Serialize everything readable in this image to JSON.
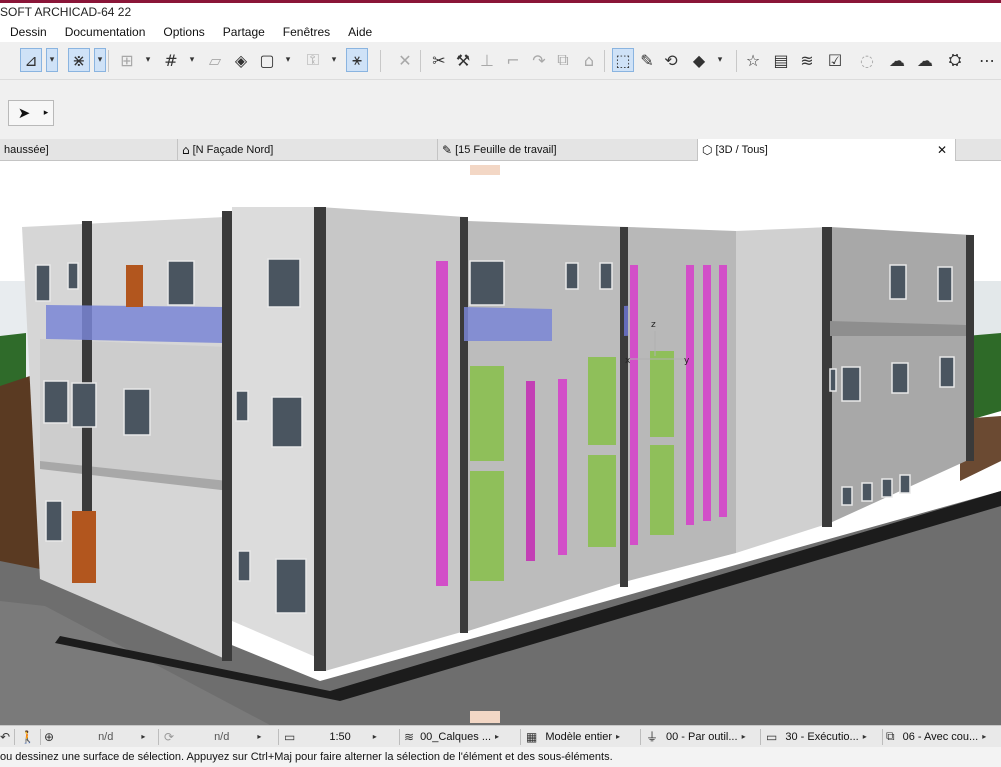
{
  "window": {
    "title": "SOFT ARCHICAD-64 22"
  },
  "menu": [
    "Dessin",
    "Documentation",
    "Options",
    "Partage",
    "Fenêtres",
    "Aide"
  ],
  "toolbar": {
    "icons": [
      {
        "name": "angle-snap-icon",
        "glyph": "⊿",
        "active": true
      },
      {
        "name": "dropdown-arrow-icon",
        "glyph": "▾",
        "small": true,
        "active": true
      },
      {
        "name": "guide-lines-icon",
        "glyph": "⋇",
        "active": true
      },
      {
        "name": "dropdown-arrow-icon",
        "glyph": "▾",
        "small": true,
        "active": true
      },
      {
        "name": "snap-points-icon",
        "glyph": "⊞",
        "dim": true
      },
      {
        "name": "dropdown-arrow-icon",
        "glyph": "▾",
        "small": true
      },
      {
        "name": "grid-icon",
        "glyph": "#"
      },
      {
        "name": "dropdown-arrow-icon",
        "glyph": "▾",
        "small": true
      },
      {
        "name": "slab-icon",
        "glyph": "▱",
        "dim": true
      },
      {
        "name": "plane-icon",
        "glyph": "◈"
      },
      {
        "name": "rectangle-icon",
        "glyph": "▢"
      },
      {
        "name": "dropdown-arrow-icon",
        "glyph": "▾",
        "small": true
      },
      {
        "name": "lock-icon",
        "glyph": "⚿",
        "dim": true
      },
      {
        "name": "dropdown-arrow-icon",
        "glyph": "▾",
        "small": true
      },
      {
        "name": "magic-wand-icon",
        "glyph": "⚹",
        "active": true
      },
      {
        "name": "cross-icon",
        "glyph": "✕",
        "dim": true
      },
      {
        "name": "scissors-icon",
        "glyph": "✂"
      },
      {
        "name": "hammer-icon",
        "glyph": "⚒"
      },
      {
        "name": "trim-icon",
        "glyph": "⊥",
        "dim": true
      },
      {
        "name": "corner-icon",
        "glyph": "⌐",
        "dim": true
      },
      {
        "name": "curve-icon",
        "glyph": "↷",
        "dim": true
      },
      {
        "name": "group-icon",
        "glyph": "⧉",
        "dim": true
      },
      {
        "name": "house-icon",
        "glyph": "⌂",
        "dim": true
      },
      {
        "name": "selection-icon",
        "glyph": "⬚",
        "active": true
      },
      {
        "name": "pencil-icon",
        "glyph": "✎"
      },
      {
        "name": "sync-icon",
        "glyph": "⟲"
      },
      {
        "name": "diamond-icon",
        "glyph": "◆"
      },
      {
        "name": "dropdown-arrow-icon",
        "glyph": "▾",
        "small": true
      },
      {
        "name": "star-icon",
        "glyph": "☆"
      },
      {
        "name": "chart-icon",
        "glyph": "▤"
      },
      {
        "name": "layers-icon",
        "glyph": "≋"
      },
      {
        "name": "checklist-icon",
        "glyph": "☑"
      },
      {
        "name": "chat-icon",
        "glyph": "◌",
        "dim": true
      },
      {
        "name": "cloud-send-icon",
        "glyph": "☁"
      },
      {
        "name": "cloud-receive-icon",
        "glyph": "☁"
      },
      {
        "name": "tools-icon",
        "glyph": "⛭"
      },
      {
        "name": "more-icon",
        "glyph": "⋯"
      }
    ],
    "pointer_glyph": "➤",
    "pointer_arrow": "▸"
  },
  "tabs": [
    {
      "label": "haussée]",
      "icon": ""
    },
    {
      "label": "[N Façade Nord]",
      "icon": "⌂"
    },
    {
      "label": "[15 Feuille de travail]",
      "icon": "✎"
    },
    {
      "label": "[3D / Tous]",
      "icon": "⬡",
      "close": "✕"
    }
  ],
  "viewport": {
    "axis_labels": [
      "x",
      "y",
      "z"
    ],
    "colors": {
      "wall_light": "#d4d4d4",
      "wall_mid": "#bdbdbd",
      "wall_dark": "#9c9c9c",
      "column_dark": "#3a3a3a",
      "glass_pink": "#d24fc8",
      "glass_green": "#8fbf5a",
      "glass_blue": "#7a86d6",
      "door_orange": "#b2561e",
      "road": "#6e6e6e",
      "ground": "#7a4a2a"
    }
  },
  "status": {
    "undo_icon": "↶",
    "walk_icon": "🚶",
    "zoom_value": "n/d",
    "angle_value": "n/d",
    "scale": "1:50",
    "layers": "00_Calques ...",
    "model": "Modèle entier",
    "pen": "00 - Par outil...",
    "mode": "30 - Exécutio...",
    "renovation": "06 - Avec cou..."
  },
  "hint": "ou dessinez une surface de sélection. Appuyez sur Ctrl+Maj pour faire alterner la sélection de l'élément et des sous-éléments."
}
